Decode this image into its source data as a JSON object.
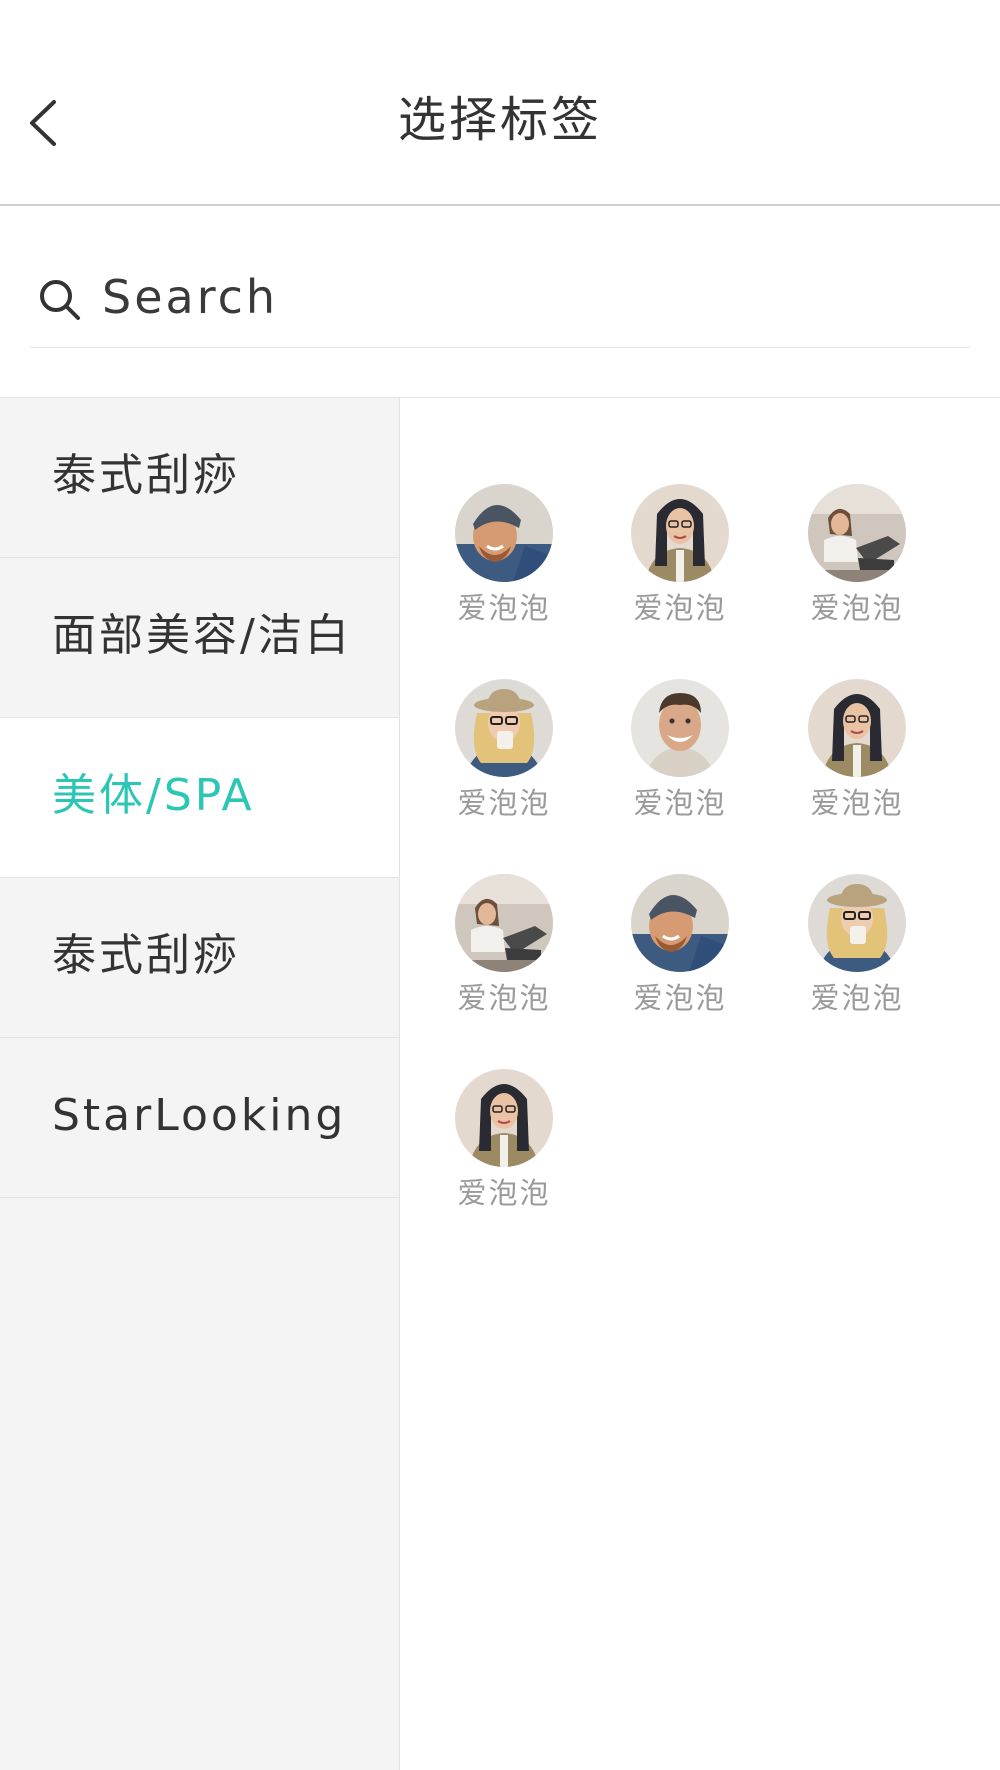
{
  "header": {
    "title": "选择标签",
    "back_icon": "chevron-left-icon"
  },
  "search": {
    "placeholder": "Search",
    "value": "",
    "icon": "search-icon"
  },
  "sidebar": {
    "items": [
      {
        "label": "泰式刮痧",
        "active": false
      },
      {
        "label": "面部美容/洁白",
        "active": false
      },
      {
        "label": "美体/SPA",
        "active": true
      },
      {
        "label": "泰式刮痧",
        "active": false
      },
      {
        "label": "StarLooking",
        "active": false
      }
    ]
  },
  "colors": {
    "accent": "#2cc6b4",
    "sidebar_bg": "#f4f4f4",
    "label_gray": "#9a9a9a"
  },
  "grid": {
    "items": [
      {
        "label": "爱泡泡",
        "avatar": "man-beanie"
      },
      {
        "label": "爱泡泡",
        "avatar": "woman-dark-hair"
      },
      {
        "label": "爱泡泡",
        "avatar": "woman-sitting"
      },
      {
        "label": "爱泡泡",
        "avatar": "woman-blonde-hat"
      },
      {
        "label": "爱泡泡",
        "avatar": "man-smiling"
      },
      {
        "label": "爱泡泡",
        "avatar": "woman-dark-hair"
      },
      {
        "label": "爱泡泡",
        "avatar": "woman-sitting"
      },
      {
        "label": "爱泡泡",
        "avatar": "man-beanie"
      },
      {
        "label": "爱泡泡",
        "avatar": "woman-blonde-hat"
      },
      {
        "label": "爱泡泡",
        "avatar": "woman-dark-hair"
      }
    ]
  }
}
